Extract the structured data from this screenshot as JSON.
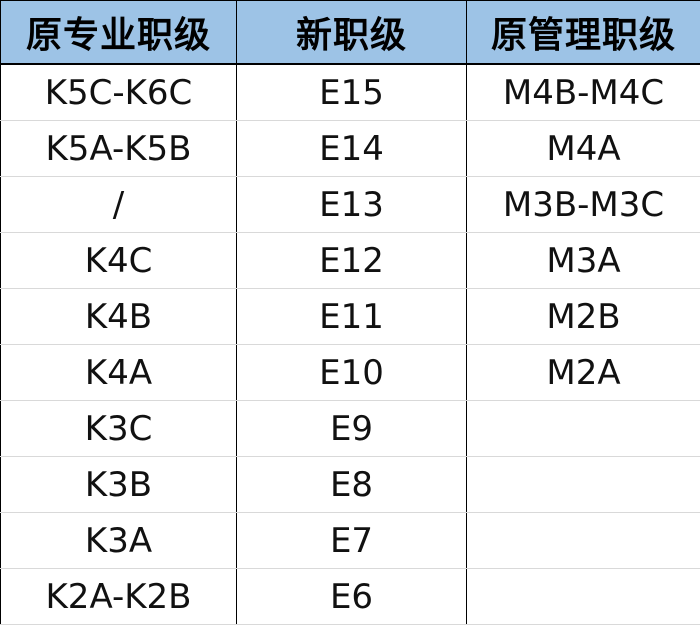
{
  "table": {
    "headers": {
      "professional": "原专业职级",
      "new": "新职级",
      "management": "原管理职级"
    },
    "rows": [
      {
        "professional": "K5C-K6C",
        "new": "E15",
        "management": "M4B-M4C"
      },
      {
        "professional": "K5A-K5B",
        "new": "E14",
        "management": "M4A"
      },
      {
        "professional": "/",
        "new": "E13",
        "management": "M3B-M3C"
      },
      {
        "professional": "K4C",
        "new": "E12",
        "management": "M3A"
      },
      {
        "professional": "K4B",
        "new": "E11",
        "management": "M2B"
      },
      {
        "professional": "K4A",
        "new": "E10",
        "management": "M2A"
      },
      {
        "professional": "K3C",
        "new": "E9",
        "management": ""
      },
      {
        "professional": "K3B",
        "new": "E8",
        "management": ""
      },
      {
        "professional": "K3A",
        "new": "E7",
        "management": ""
      },
      {
        "professional": "K2A-K2B",
        "new": "E6",
        "management": ""
      }
    ]
  }
}
